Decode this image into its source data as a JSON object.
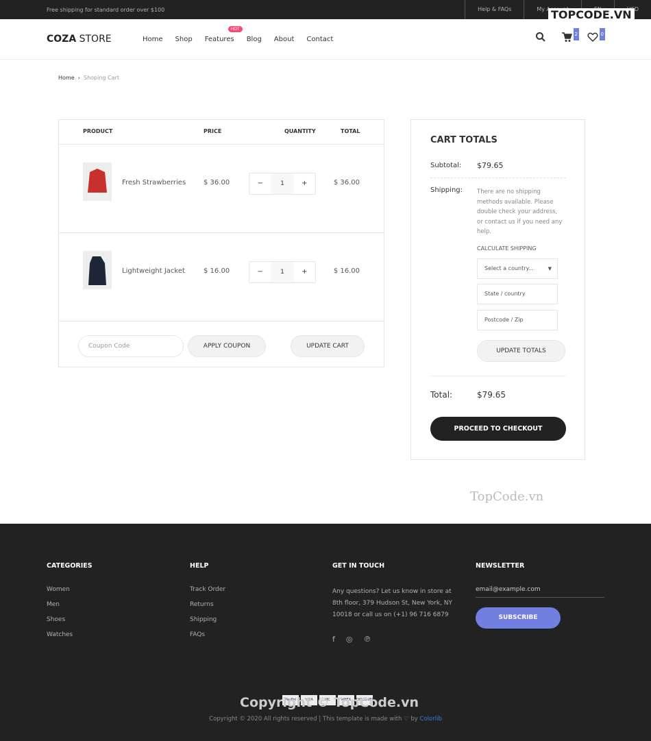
{
  "topbar": {
    "shipping": "Free shipping for standard order over $100",
    "links": [
      "Help & FAQs",
      "My Account",
      "EN",
      "USD"
    ]
  },
  "header": {
    "logo_bold": "COZA",
    "logo_rest": " STORE",
    "nav": [
      "Home",
      "Shop",
      "Features",
      "Blog",
      "About",
      "Contact"
    ],
    "hot_badge": "HOT",
    "cart_count": "2",
    "wishlist_count": "0"
  },
  "breadcrumb": {
    "home": "Home",
    "current": "Shoping Cart"
  },
  "cart": {
    "headers": [
      "PRODUCT",
      "PRICE",
      "QUANTITY",
      "TOTAL"
    ],
    "items": [
      {
        "name": "Fresh Strawberries",
        "price": "$ 36.00",
        "qty": "1",
        "total": "$ 36.00",
        "color": "#c8302e"
      },
      {
        "name": "Lightweight Jacket",
        "price": "$ 16.00",
        "qty": "1",
        "total": "$ 16.00",
        "color": "#1e2638"
      }
    ],
    "coupon_placeholder": "Coupon Code",
    "apply": "APPLY COUPON",
    "update": "UPDATE CART"
  },
  "totals": {
    "title": "CART TOTALS",
    "subtotal_label": "Subtotal:",
    "subtotal": "$79.65",
    "shipping_label": "Shipping:",
    "shipping_note": "There are no shipping methods available. Please double check your address, or contact us if you need any help.",
    "calc": "CALCULATE SHIPPING",
    "country": "Select a country...",
    "state": "State /  country",
    "postcode": "Postcode / Zip",
    "update": "UPDATE TOTALS",
    "total_label": "Total:",
    "total": "$79.65",
    "checkout": "PROCEED TO CHECKOUT"
  },
  "footer": {
    "categories": {
      "title": "CATEGORIES",
      "items": [
        "Women",
        "Men",
        "Shoes",
        "Watches"
      ]
    },
    "help": {
      "title": "HELP",
      "items": [
        "Track Order",
        "Returns",
        "Shipping",
        "FAQs"
      ]
    },
    "contact": {
      "title": "GET IN TOUCH",
      "text": "Any questions? Let us know in store at 8th floor, 379 Hudson St, New York, NY 10018 or call us on (+1) 96 716 6879"
    },
    "newsletter": {
      "title": "NEWSLETTER",
      "placeholder": "email@example.com",
      "button": "SUBSCRIBE"
    },
    "payments": [
      "PayPal",
      "VISA",
      "MC",
      "AMEX",
      "DISCOVER"
    ],
    "copyright": "Copyright © 2020 All rights reserved | This template is made with ♡ by",
    "colorlib": "Colorlib"
  },
  "watermarks": [
    "TOPCODE.VN",
    "TopCode.vn",
    "Copyright © TopCode.vn"
  ]
}
